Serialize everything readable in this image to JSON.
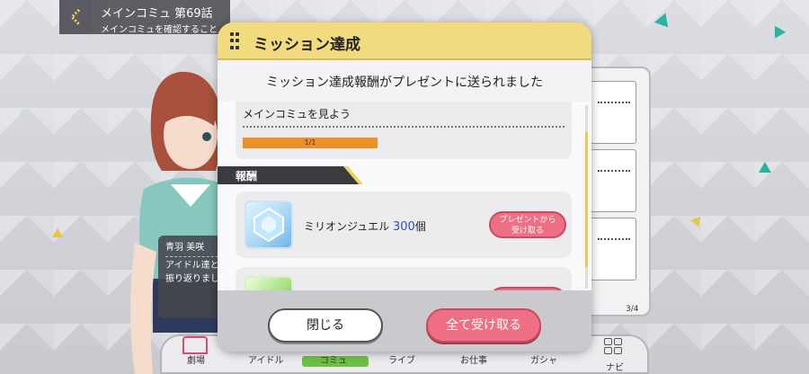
{
  "header": {
    "title": "メインコミュ 第69話",
    "subtitle": "メインコミュを確認すること"
  },
  "character": {
    "name": "青羽 美咲",
    "dialogue_line1": "アイドル達と",
    "dialogue_line2": "振り返りまし"
  },
  "side_panel": {
    "page_indicator": "3/4"
  },
  "bottom_nav": {
    "items": [
      "劇場",
      "アイドル",
      "コミュ",
      "ライブ",
      "お仕事",
      "ガシャ",
      "ナビ"
    ]
  },
  "dialog": {
    "title": "ミッション達成",
    "message": "ミッション達成報酬がプレゼントに送られました",
    "mission": {
      "name": "メインコミュを見よう",
      "progress_text": "1/1",
      "progress": 1.0
    },
    "reward_header": "報酬",
    "rewards": [
      {
        "name": "ミリオンジュエル",
        "quantity": "300",
        "unit": "個",
        "receive_label_line1": "プレゼントから",
        "receive_label_line2": "受け取る"
      }
    ],
    "close_label": "閉じる",
    "receive_all_label": "全て受け取る"
  },
  "colors": {
    "header_yellow": "#f1db7e",
    "accent_pink": "#ef6f84",
    "progress_orange": "#f08e2a",
    "quantity_blue": "#2a4fb8"
  }
}
